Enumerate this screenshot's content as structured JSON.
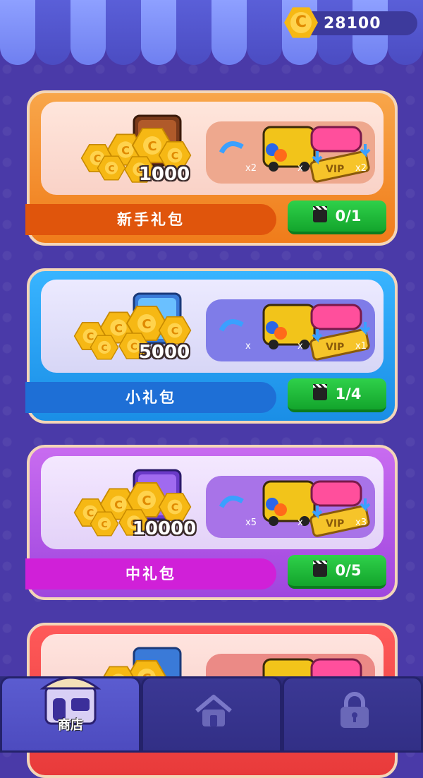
{
  "header": {
    "coin_balance": "28100",
    "coin_symbol": "C"
  },
  "packs": [
    {
      "amount": "1000",
      "name": "新手礼包",
      "ad_progress": "0/1",
      "reward_labels": [
        "x2",
        "x",
        "x2"
      ]
    },
    {
      "amount": "5000",
      "name": "小礼包",
      "ad_progress": "1/4",
      "reward_labels": [
        "x",
        "x",
        "x1"
      ]
    },
    {
      "amount": "10000",
      "name": "中礼包",
      "ad_progress": "0/5",
      "reward_labels": [
        "x5",
        "x",
        "x3"
      ]
    }
  ],
  "nav": {
    "tabs": [
      {
        "label": "商店",
        "icon": "shop-icon",
        "active": true
      },
      {
        "label": "",
        "icon": "home-icon",
        "active": false
      },
      {
        "label": "",
        "icon": "lock-icon",
        "active": false
      }
    ]
  },
  "colors": {
    "background": "#4a3aa8",
    "coin": "#f6b814",
    "ad_button": "#1fbd3a"
  }
}
